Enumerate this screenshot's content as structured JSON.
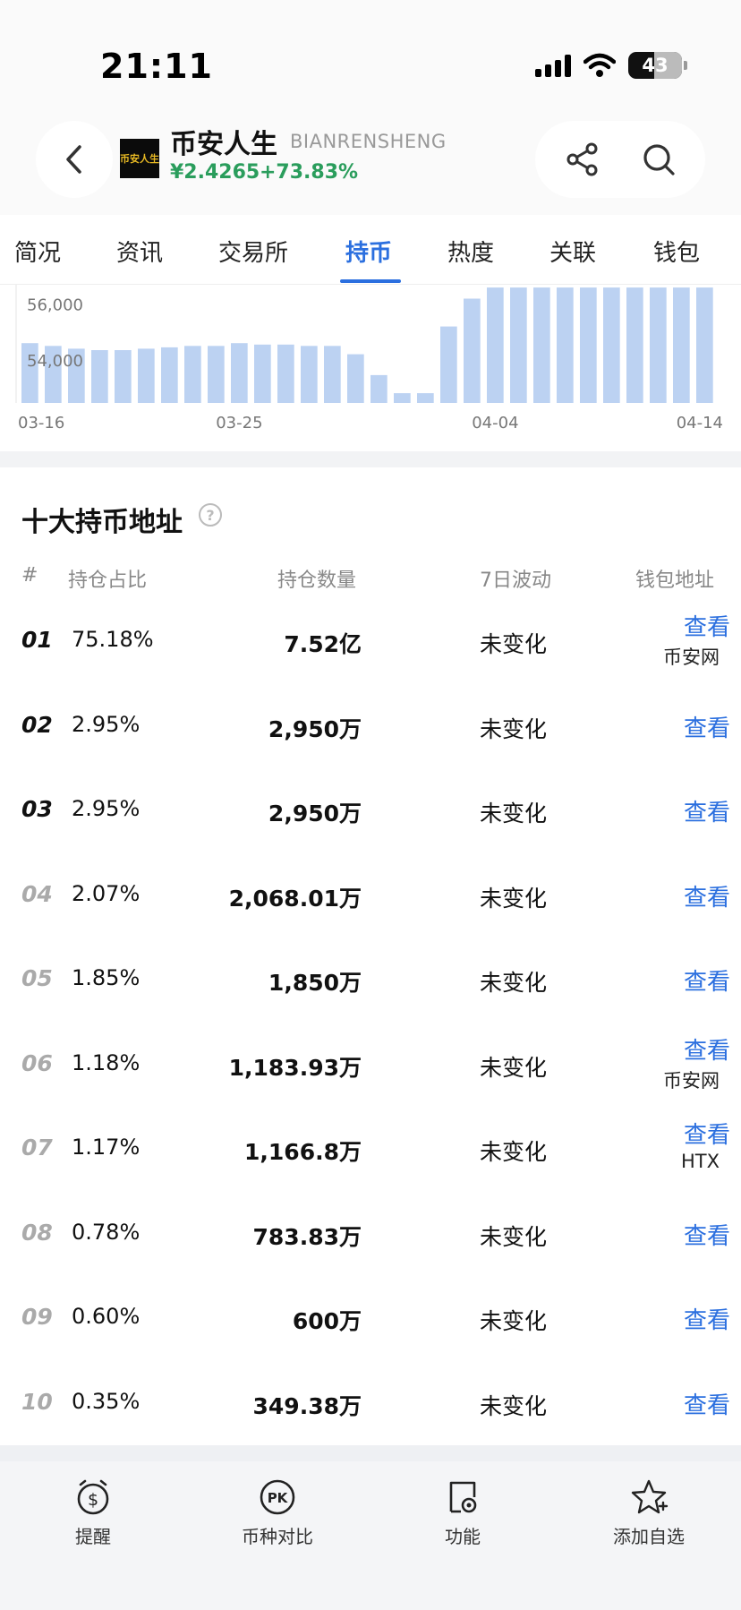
{
  "status_bar": {
    "time": "21:11",
    "battery": "43"
  },
  "header": {
    "coin_name": "币安人生",
    "coin_symbol": "BIANRENSHENG",
    "logo_text": "币安人生",
    "price": "¥2.4265",
    "change": "+73.83%",
    "price_color": "#2a9d5c"
  },
  "tabs": [
    {
      "label": "简况"
    },
    {
      "label": "资讯"
    },
    {
      "label": "交易所"
    },
    {
      "label": "持币",
      "active": true
    },
    {
      "label": "热度"
    },
    {
      "label": "关联"
    },
    {
      "label": "钱包"
    }
  ],
  "chart_data": {
    "type": "bar",
    "y_tick_labels": [
      "56,000",
      "54,000"
    ],
    "x_tick_labels": [
      "03-16",
      "03-25",
      "04-04",
      "04-14"
    ],
    "values": [
      54600,
      54500,
      54400,
      54350,
      54350,
      54400,
      54450,
      54500,
      54500,
      54600,
      54550,
      54550,
      54500,
      54500,
      54200,
      53450,
      52800,
      52800,
      55200,
      56200,
      56600,
      56600,
      56600,
      56600,
      56600,
      56600,
      56600,
      56600,
      56600,
      56600
    ],
    "ylim": [
      52450,
      56700
    ],
    "bar_color": "#bcd2f2"
  },
  "holders": {
    "title": "十大持币地址",
    "help_icon": "question-circle-icon",
    "columns": {
      "rank": "#",
      "share": "持仓占比",
      "amount": "持仓数量",
      "change": "7日波动",
      "wallet": "钱包地址"
    },
    "rows": [
      {
        "rank": "01",
        "share": "75.18%",
        "amount": "7.52亿",
        "change": "未变化",
        "view": "查看",
        "tag": "币安网"
      },
      {
        "rank": "02",
        "share": "2.95%",
        "amount": "2,950万",
        "change": "未变化",
        "view": "查看",
        "tag": ""
      },
      {
        "rank": "03",
        "share": "2.95%",
        "amount": "2,950万",
        "change": "未变化",
        "view": "查看",
        "tag": ""
      },
      {
        "rank": "04",
        "share": "2.07%",
        "amount": "2,068.01万",
        "change": "未变化",
        "view": "查看",
        "tag": ""
      },
      {
        "rank": "05",
        "share": "1.85%",
        "amount": "1,850万",
        "change": "未变化",
        "view": "查看",
        "tag": ""
      },
      {
        "rank": "06",
        "share": "1.18%",
        "amount": "1,183.93万",
        "change": "未变化",
        "view": "查看",
        "tag": "币安网"
      },
      {
        "rank": "07",
        "share": "1.17%",
        "amount": "1,166.8万",
        "change": "未变化",
        "view": "查看",
        "tag": "HTX"
      },
      {
        "rank": "08",
        "share": "0.78%",
        "amount": "783.83万",
        "change": "未变化",
        "view": "查看",
        "tag": ""
      },
      {
        "rank": "09",
        "share": "0.60%",
        "amount": "600万",
        "change": "未变化",
        "view": "查看",
        "tag": ""
      },
      {
        "rank": "10",
        "share": "0.35%",
        "amount": "349.38万",
        "change": "未变化",
        "view": "查看",
        "tag": ""
      }
    ]
  },
  "toolbar": {
    "items": [
      {
        "label": "提醒",
        "icon": "alarm-dollar-icon"
      },
      {
        "label": "币种对比",
        "icon": "pk-compare-icon"
      },
      {
        "label": "功能",
        "icon": "function-settings-icon"
      },
      {
        "label": "添加自选",
        "icon": "star-add-icon"
      }
    ]
  },
  "colors": {
    "accent": "#2b6fdf",
    "up": "#2a9d5c"
  }
}
